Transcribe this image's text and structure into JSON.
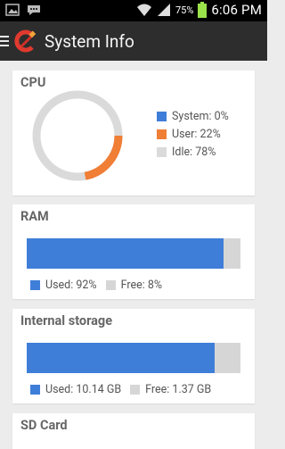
{
  "status_bar": {
    "battery_pct": "75%",
    "time": "6:06 PM",
    "icons": [
      "gallery-icon",
      "chat-icon",
      "wifi-icon",
      "signal-icon",
      "battery-icon"
    ]
  },
  "app_bar": {
    "title": "System Info",
    "logo_icon": "ccleaner-logo"
  },
  "colors": {
    "system": "#3f7ed8",
    "user": "#f07e35",
    "idle": "#dadada",
    "used": "#3f7ed8",
    "free": "#d6d6d6"
  },
  "cpu": {
    "title": "CPU",
    "legend": [
      {
        "label": "System: 0%",
        "color": "#3f7ed8"
      },
      {
        "label": "User: 22%",
        "color": "#f07e35"
      },
      {
        "label": "Idle: 78%",
        "color": "#dadada"
      }
    ],
    "user_fraction": 0.22
  },
  "ram": {
    "title": "RAM",
    "used_label": "Used: 92%",
    "free_label": "Free: 8%",
    "used_fraction": 0.92
  },
  "internal_storage": {
    "title": "Internal storage",
    "used_label": "Used: 10.14 GB",
    "free_label": "Free: 1.37 GB",
    "used_fraction": 0.881
  },
  "sd_card": {
    "title": "SD Card"
  }
}
